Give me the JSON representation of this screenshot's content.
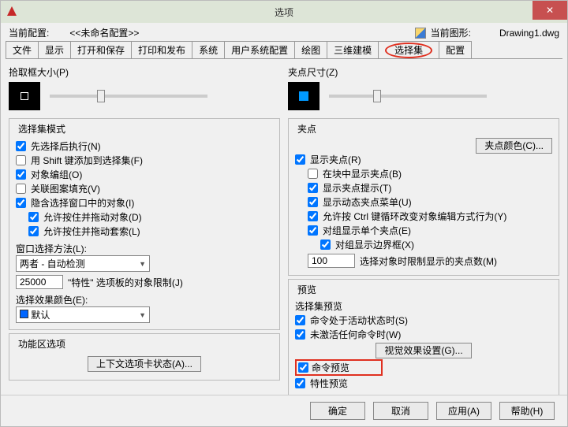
{
  "title": "选项",
  "close": "✕",
  "header": {
    "profile_label": "当前配置:",
    "profile_value": "<<未命名配置>>",
    "drawing_label": "当前图形:",
    "drawing_value": "Drawing1.dwg"
  },
  "tabs": [
    "文件",
    "显示",
    "打开和保存",
    "打印和发布",
    "系统",
    "用户系统配置",
    "绘图",
    "三维建模",
    "选择集",
    "配置"
  ],
  "pickbox": {
    "title": "拾取框大小(P)"
  },
  "gripsize": {
    "title": "夹点尺寸(Z)"
  },
  "selmode": {
    "title": "选择集模式",
    "i0": "先选择后执行(N)",
    "i1": "用 Shift 键添加到选择集(F)",
    "i2": "对象编组(O)",
    "i3": "关联图案填充(V)",
    "i4": "隐含选择窗口中的对象(I)",
    "i5": "允许按住并拖动对象(D)",
    "i6": "允许按住并拖动套索(L)",
    "wsm_label": "窗口选择方法(L):",
    "wsm_value": "两者 - 自动检测",
    "limit_value": "25000",
    "limit_label": "\"特性\" 选项板的对象限制(J)",
    "effcolor_label": "选择效果颜色(E):",
    "effcolor_value": "默认"
  },
  "ribbon": {
    "title": "功能区选项",
    "btn": "上下文选项卡状态(A)..."
  },
  "grips": {
    "title": "夹点",
    "color_btn": "夹点颜色(C)...",
    "g0": "显示夹点(R)",
    "g1": "在块中显示夹点(B)",
    "g2": "显示夹点提示(T)",
    "g3": "显示动态夹点菜单(U)",
    "g4": "允许按 Ctrl 键循环改变对象编辑方式行为(Y)",
    "g5": "对组显示单个夹点(E)",
    "g6": "对组显示边界框(X)",
    "limit_value": "100",
    "limit_label": "选择对象时限制显示的夹点数(M)"
  },
  "preview": {
    "title": "预览",
    "sub": "选择集预览",
    "p0": "命令处于活动状态时(S)",
    "p1": "未激活任何命令时(W)",
    "btn": "视觉效果设置(G)...",
    "p2": "命令预览",
    "p3": "特性预览"
  },
  "footer": {
    "ok": "确定",
    "cancel": "取消",
    "apply": "应用(A)",
    "help": "帮助(H)"
  }
}
